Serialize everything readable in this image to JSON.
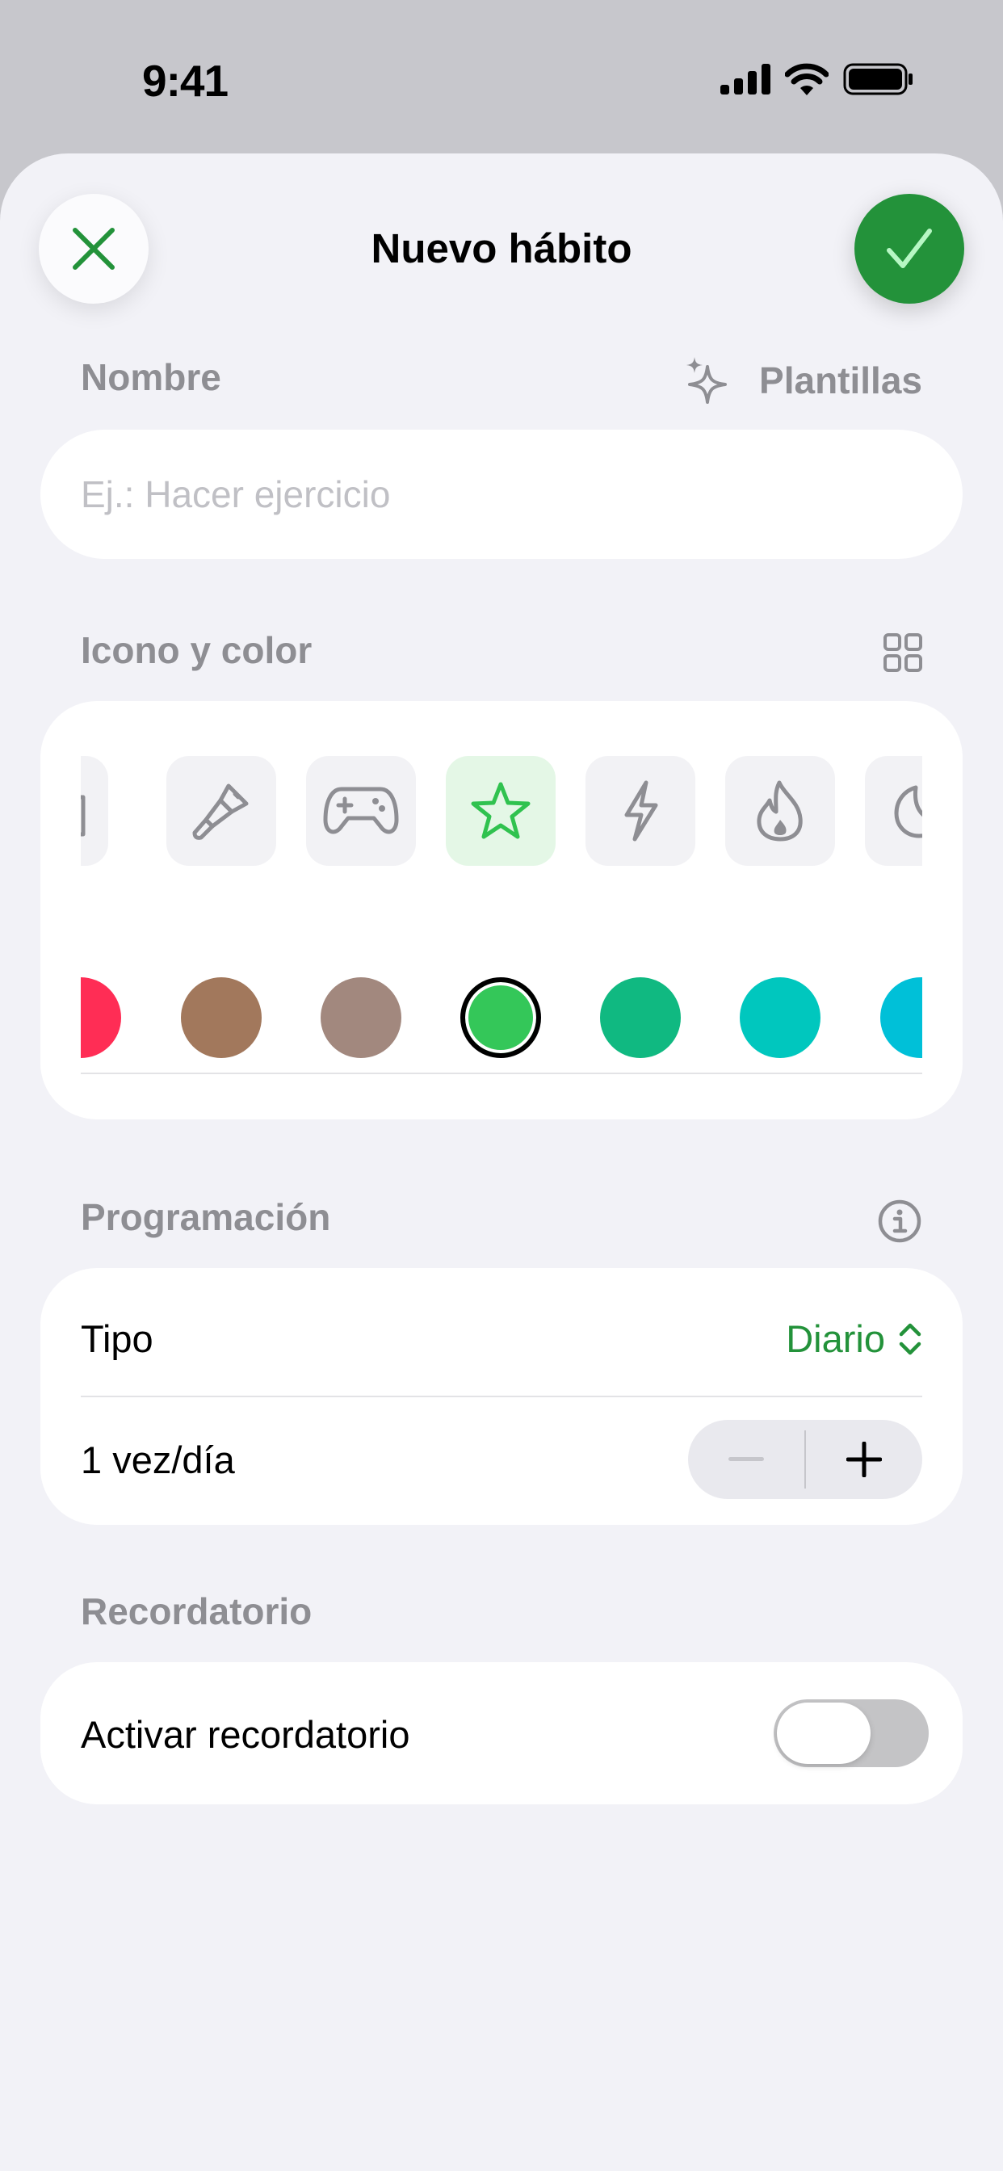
{
  "status_bar": {
    "time": "9:41",
    "icons": [
      "cellular-signal-icon",
      "wifi-icon",
      "battery-icon"
    ]
  },
  "header": {
    "title": "Nuevo hábito",
    "close_icon": "close-icon",
    "done_icon": "checkmark-icon"
  },
  "name_section": {
    "label": "Nombre",
    "templates_label": "Plantillas",
    "templates_icon": "sparkles-icon",
    "input_placeholder": "Ej.: Hacer ejercicio",
    "input_value": ""
  },
  "icon_color_section": {
    "label": "Icono y color",
    "grid_icon": "grid-icon",
    "icons": [
      {
        "name": "camera-icon",
        "selected": false
      },
      {
        "name": "paintbrush-icon",
        "selected": false
      },
      {
        "name": "gamecontroller-icon",
        "selected": false
      },
      {
        "name": "star-icon",
        "selected": true
      },
      {
        "name": "bolt-icon",
        "selected": false
      },
      {
        "name": "flame-icon",
        "selected": false
      },
      {
        "name": "moon-icon",
        "selected": false
      }
    ],
    "colors": [
      {
        "hex": "#ff2d55",
        "selected": false
      },
      {
        "hex": "#a2785c",
        "selected": false
      },
      {
        "hex": "#a2887e",
        "selected": false
      },
      {
        "hex": "#34c759",
        "selected": true
      },
      {
        "hex": "#10b981",
        "selected": false
      },
      {
        "hex": "#00c7be",
        "selected": false
      },
      {
        "hex": "#00c0d8",
        "selected": false
      }
    ]
  },
  "schedule_section": {
    "label": "Programación",
    "info_icon": "info-icon",
    "type_label": "Tipo",
    "type_value": "Diario",
    "frequency_label": "1 vez/día",
    "decrement_icon": "minus-icon",
    "increment_icon": "plus-icon"
  },
  "reminder_section": {
    "label": "Recordatorio",
    "toggle_label": "Activar recordatorio",
    "enabled": false
  },
  "colors": {
    "accent": "#23923a",
    "background": "#f2f2f7",
    "secondary_text": "#8e8e93"
  }
}
